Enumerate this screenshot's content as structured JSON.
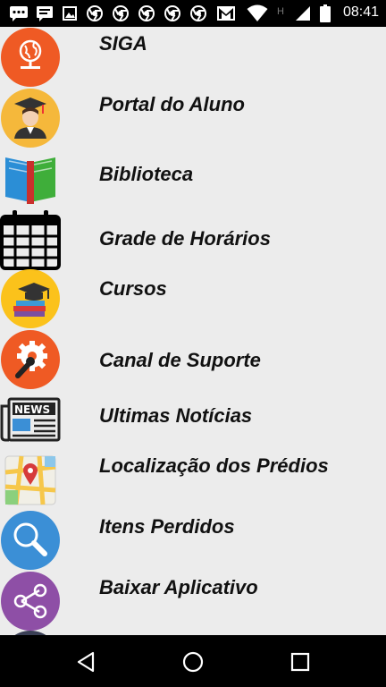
{
  "status_bar": {
    "time": "08:41",
    "icons": [
      "message-icon",
      "chat-icon",
      "image-icon",
      "chrome-icon",
      "chrome-icon",
      "chrome-icon",
      "chrome-icon",
      "chrome-icon",
      "gmail-icon",
      "wifi-icon",
      "network-h-icon",
      "signal-icon",
      "battery-icon"
    ],
    "network_type": "H"
  },
  "menu": {
    "items": [
      {
        "label": "SIGA",
        "icon": "globe-computer-icon",
        "icon_bg": "#ef5a24"
      },
      {
        "label": "Portal do Aluno",
        "icon": "graduate-student-icon",
        "icon_bg": "#f5b83b"
      },
      {
        "label": "Biblioteca",
        "icon": "book-icon",
        "icon_bg": "none"
      },
      {
        "label": "Grade de Horários",
        "icon": "calendar-icon",
        "icon_bg": "none"
      },
      {
        "label": "Cursos",
        "icon": "books-graduation-cap-icon",
        "icon_bg": "#fbc21b"
      },
      {
        "label": "Canal de Suporte",
        "icon": "gear-wrench-icon",
        "icon_bg": "#ef5a24"
      },
      {
        "label": "Ultimas Notícias",
        "icon": "newspaper-icon",
        "icon_bg": "none"
      },
      {
        "label": "Localização dos Prédios",
        "icon": "map-pin-icon",
        "icon_bg": "none"
      },
      {
        "label": "Itens Perdidos",
        "icon": "magnifier-icon",
        "icon_bg": "#3b8fd6"
      },
      {
        "label": "Baixar Aplicativo",
        "icon": "share-icon",
        "icon_bg": "#8e4fa6"
      }
    ]
  },
  "nav_bar": {
    "buttons": [
      "back-icon",
      "home-icon",
      "recent-apps-icon"
    ]
  }
}
